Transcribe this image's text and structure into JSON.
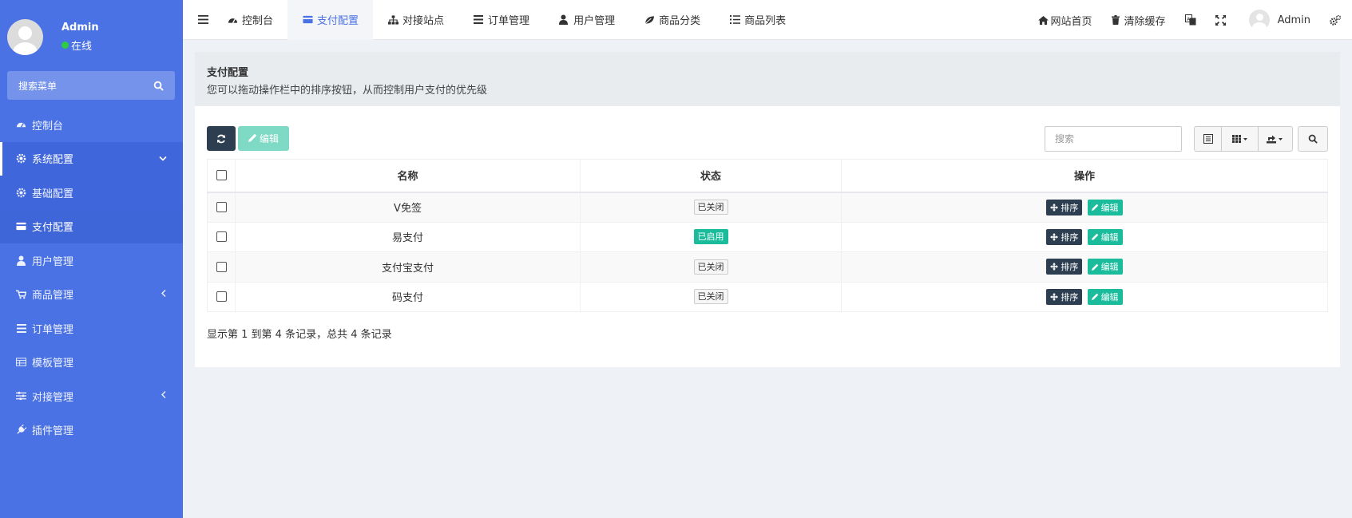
{
  "sidebar": {
    "user": {
      "name": "Admin",
      "status": "在线"
    },
    "search_label": "搜索菜单",
    "items": [
      {
        "label": "控制台",
        "icon": "dashboard-icon"
      },
      {
        "label": "系统配置",
        "icon": "gear-icon"
      },
      {
        "label": "基础配置",
        "icon": "gear-icon"
      },
      {
        "label": "支付配置",
        "icon": "credit-card-icon"
      },
      {
        "label": "用户管理",
        "icon": "user-icon"
      },
      {
        "label": "商品管理",
        "icon": "cart-icon"
      },
      {
        "label": "订单管理",
        "icon": "list-icon"
      },
      {
        "label": "模板管理",
        "icon": "table-icon"
      },
      {
        "label": "对接管理",
        "icon": "sliders-icon"
      },
      {
        "label": "插件管理",
        "icon": "plug-icon"
      }
    ]
  },
  "topbar": {
    "tabs": [
      {
        "label": "控制台",
        "icon": "dashboard-icon"
      },
      {
        "label": "支付配置",
        "icon": "credit-card-icon"
      },
      {
        "label": "对接站点",
        "icon": "sitemap-icon"
      },
      {
        "label": "订单管理",
        "icon": "list-icon"
      },
      {
        "label": "用户管理",
        "icon": "user-icon"
      },
      {
        "label": "商品分类",
        "icon": "leaf-icon"
      },
      {
        "label": "商品列表",
        "icon": "list-ul-icon"
      }
    ],
    "site_home": "网站首页",
    "clear_cache": "清除缓存",
    "user_name": "Admin"
  },
  "panel": {
    "title": "支付配置",
    "description": "您可以拖动操作栏中的排序按钮，从而控制用户支付的优先级"
  },
  "toolbar": {
    "edit_label": "编辑",
    "search_placeholder": "搜索"
  },
  "table": {
    "headers": {
      "name": "名称",
      "status": "状态",
      "actions": "操作"
    },
    "rows": [
      {
        "name": "V免签",
        "status": "已关闭",
        "enabled": false
      },
      {
        "name": "易支付",
        "status": "已启用",
        "enabled": true
      },
      {
        "name": "支付宝支付",
        "status": "已关闭",
        "enabled": false
      },
      {
        "name": "码支付",
        "status": "已关闭",
        "enabled": false
      }
    ],
    "sort_label": "排序",
    "edit_label": "编辑"
  },
  "pagination": {
    "info": "显示第 1 到第 4 条记录，总共 4 条记录"
  },
  "colors": {
    "sidebar": "#4b72e4",
    "accent": "#4b72e4",
    "dark_button": "#2c3e50",
    "success": "#1abc9c"
  }
}
